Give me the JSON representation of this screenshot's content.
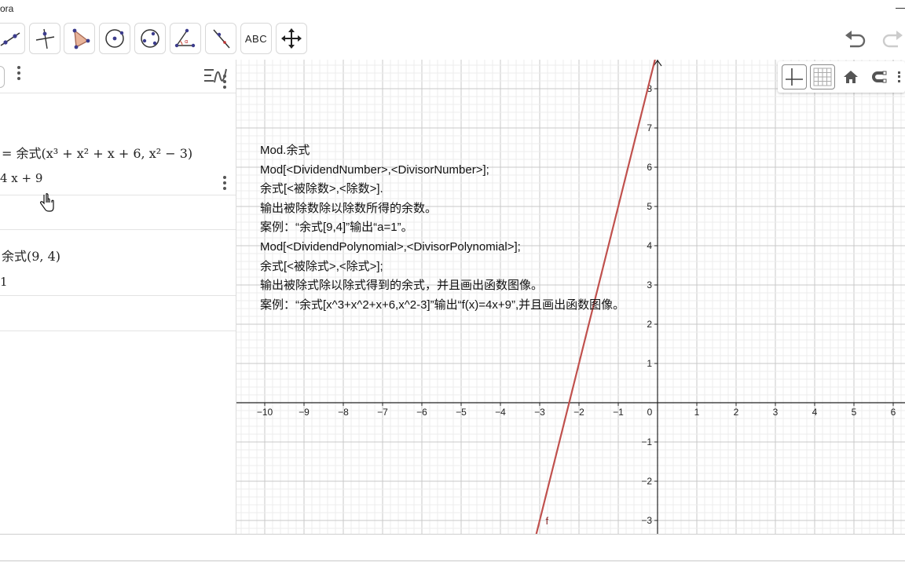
{
  "window": {
    "title": "ora"
  },
  "toolbar": {
    "tools": [
      {
        "icon": "line-tool-icon"
      },
      {
        "icon": "perpendicular-line-icon"
      },
      {
        "icon": "polygon-icon"
      },
      {
        "icon": "circle-center-point-icon"
      },
      {
        "icon": "circle-three-points-icon"
      },
      {
        "icon": "angle-icon"
      },
      {
        "icon": "reflect-line-icon"
      },
      {
        "icon": "text-tool-icon",
        "label": "ABC"
      },
      {
        "icon": "move-graphics-icon"
      }
    ]
  },
  "algebra": {
    "entry1": {
      "definition": "= 余式(x³ + x² + x + 6, x² − 3)",
      "value": "4 x + 9"
    },
    "entry2": {
      "definition": "余式(9, 4)",
      "value": "1"
    }
  },
  "graphics": {
    "function_label": "f",
    "x_ticks": [
      "−10",
      "−9",
      "−8",
      "−7",
      "−6",
      "−5",
      "−4",
      "−3",
      "−2",
      "−1",
      "0",
      "1",
      "2",
      "3",
      "4",
      "5",
      "6"
    ],
    "y_ticks": [
      "8",
      "7",
      "6",
      "5",
      "4",
      "3",
      "2",
      "1",
      "−1",
      "−2",
      "−3"
    ],
    "note_lines": [
      "Mod.余式",
      "Mod[<DividendNumber>,<DivisorNumber>];",
      "余式[<被除数>,<除数>].",
      "输出被除数除以除数所得的余数。",
      "案例：“余式[9,4]”输出“a=1”。",
      " Mod[<DividendPolynomial>,<DivisorPolynomial>];",
      " 余式[<被除式>,<除式>];",
      " 输出被除式除以除式得到的余式，并且画出函数图像。",
      " 案例：“余式[x^3+x^2+x+6,x^2-3]”输出“f(x)=4x+9”,并且画出函数图像。"
    ],
    "line_color": "#c0504d"
  }
}
